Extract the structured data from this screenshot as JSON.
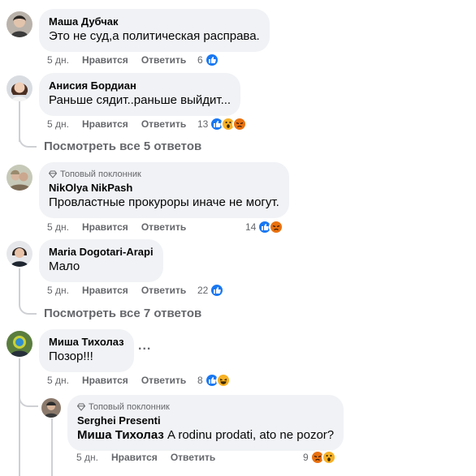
{
  "comments": [
    {
      "author": "Маша Дубчак",
      "text": "Это не суд,а политическая расправа.",
      "time": "5 дн.",
      "like": "Нравится",
      "reply": "Ответить",
      "count": "6",
      "reactions": [
        "like-icon"
      ]
    },
    {
      "author": "Анисия Бордиан",
      "text": "Раньше сядит..раньше выйдит...",
      "time": "5 дн.",
      "like": "Нравится",
      "reply": "Ответить",
      "count": "13",
      "reactions": [
        "like-icon",
        "wow-icon",
        "angry-icon"
      ],
      "view_more": "Посмотреть все 5 ответов"
    },
    {
      "badge": "Топовый поклонник",
      "author": "NikOlya NikPash",
      "text": "Провластные прокуроры иначе не могут.",
      "time": "5 дн.",
      "like": "Нравится",
      "reply": "Ответить",
      "count": "14",
      "reactions": [
        "like-icon",
        "angry-icon"
      ]
    },
    {
      "author": "Maria Dogotari-Arapi",
      "text": "Мало",
      "time": "5 дн.",
      "like": "Нравится",
      "reply": "Ответить",
      "count": "22",
      "reactions": [
        "like-icon"
      ],
      "view_more": "Посмотреть все 7 ответов"
    },
    {
      "author": "Миша Тихолаз",
      "text": "Позор!!!",
      "time": "5 дн.",
      "like": "Нравится",
      "reply": "Ответить",
      "count": "8",
      "reactions": [
        "like-icon",
        "haha-icon"
      ],
      "more_options": "..."
    }
  ],
  "reply": {
    "badge": "Топовый поклонник",
    "author": "Serghei Presenti",
    "mention": "Миша Тихолаз",
    "text": " A rodinu prodati, ato ne pozor?",
    "time": "5 дн.",
    "like": "Нравится",
    "reply": "Ответить",
    "count": "9",
    "reactions": [
      "angry-icon",
      "wow-icon"
    ]
  },
  "colors": {
    "bubble": "#f0f2f5",
    "like": "#1877f2",
    "angry": "#e9710f",
    "wow": "#f7b125",
    "meta_text": "#65676b"
  }
}
